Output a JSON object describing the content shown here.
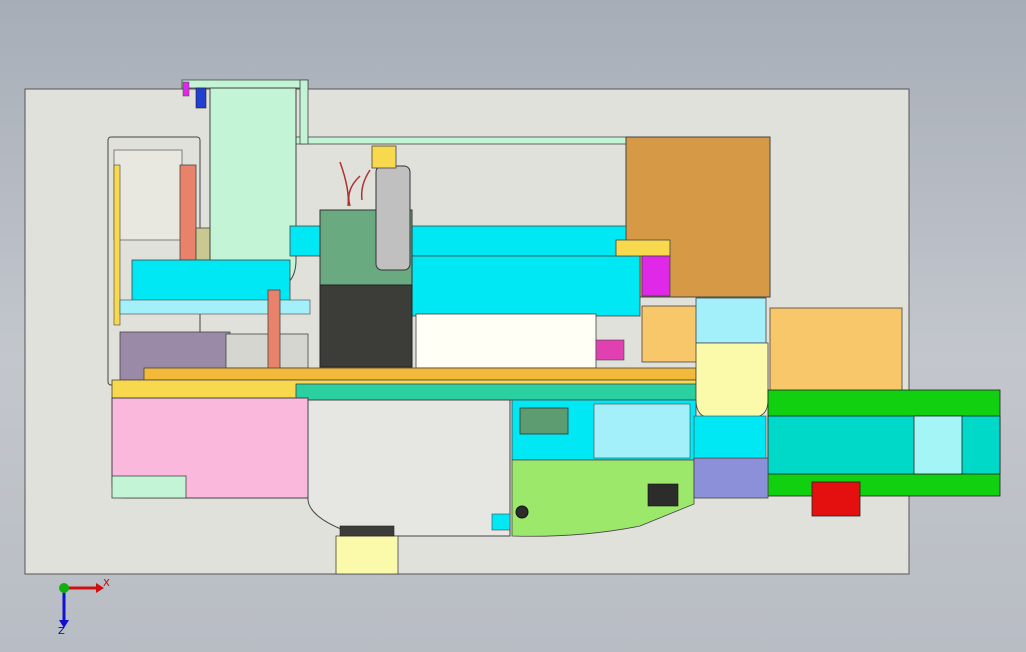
{
  "viewport": {
    "title": "",
    "background": [
      "#a7adb7",
      "#c3c7cd"
    ],
    "baseplate_color": "#e1e1db"
  },
  "triad": {
    "x_label": "X",
    "z_label": "Z",
    "x_color": "#d01010",
    "z_color": "#1010d0",
    "origin_color": "#10b010"
  },
  "colors": {
    "mint": "#c4f4d6",
    "cyan": "#00e8f4",
    "light_cyan": "#a4f0fa",
    "yellow": "#f8d84c",
    "gold": "#f2b93a",
    "orange_brown": "#d69a46",
    "peach": "#f8c76a",
    "pink": "#fab8dc",
    "green_block": "#6aaa80",
    "dark_block": "#3c3c38",
    "cream": "#fffff6",
    "lime": "#9ce86a",
    "bright_green": "#10d010",
    "teal": "#00d8c8",
    "red": "#e41010",
    "salmon": "#e8826a",
    "magenta": "#e028e8",
    "lavender": "#8c90d8",
    "purple_gray": "#9a8aa8",
    "pale_yellow": "#fafaaa"
  }
}
